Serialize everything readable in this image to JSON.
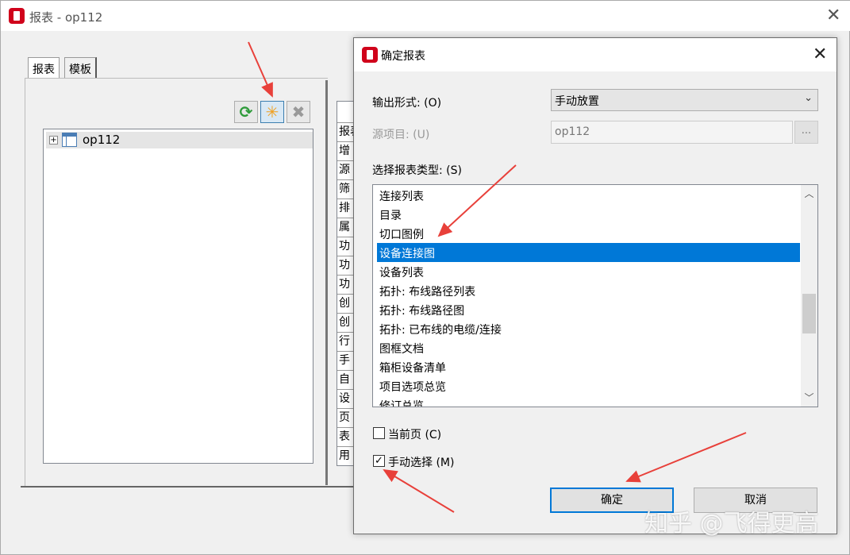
{
  "main_window": {
    "title": "报表 - op112",
    "tabs": [
      "报表",
      "模板"
    ],
    "tree": {
      "root_label": "op112"
    },
    "property_rows": [
      "报表",
      "增",
      "源",
      "筛",
      "排",
      "属",
      "功",
      "功",
      "功",
      "创",
      "创",
      "行",
      "手",
      "自",
      "设",
      "页",
      "表",
      "用"
    ]
  },
  "toolbar": {
    "refresh_icon": "refresh-icon",
    "new_icon": "new-star-icon",
    "delete_icon": "delete-x-icon"
  },
  "dialog": {
    "title": "确定报表",
    "output_form_label": "输出形式: (O)",
    "output_form_value": "手动放置",
    "source_project_label": "源项目: (U)",
    "source_project_value": "op112",
    "browse_label": "...",
    "report_type_label": "选择报表类型: (S)",
    "report_types": [
      "连接列表",
      "目录",
      "切口图例",
      "设备连接图",
      "设备列表",
      "拓扑: 布线路径列表",
      "拓扑: 布线路径图",
      "拓扑: 已布线的电缆/连接",
      "图框文档",
      "箱柜设备清单",
      "项目选项总览",
      "修订总览"
    ],
    "selected_index": 3,
    "current_page_label": "当前页 (C)",
    "current_page_checked": false,
    "manual_select_label": "手动选择 (M)",
    "manual_select_checked": true,
    "ok_label": "确定",
    "cancel_label": "取消"
  },
  "watermark": "知乎 @飞得更高",
  "colors": {
    "accent": "#0078d7",
    "app_icon": "#d0021b",
    "annotation_arrow": "#e8403a"
  }
}
